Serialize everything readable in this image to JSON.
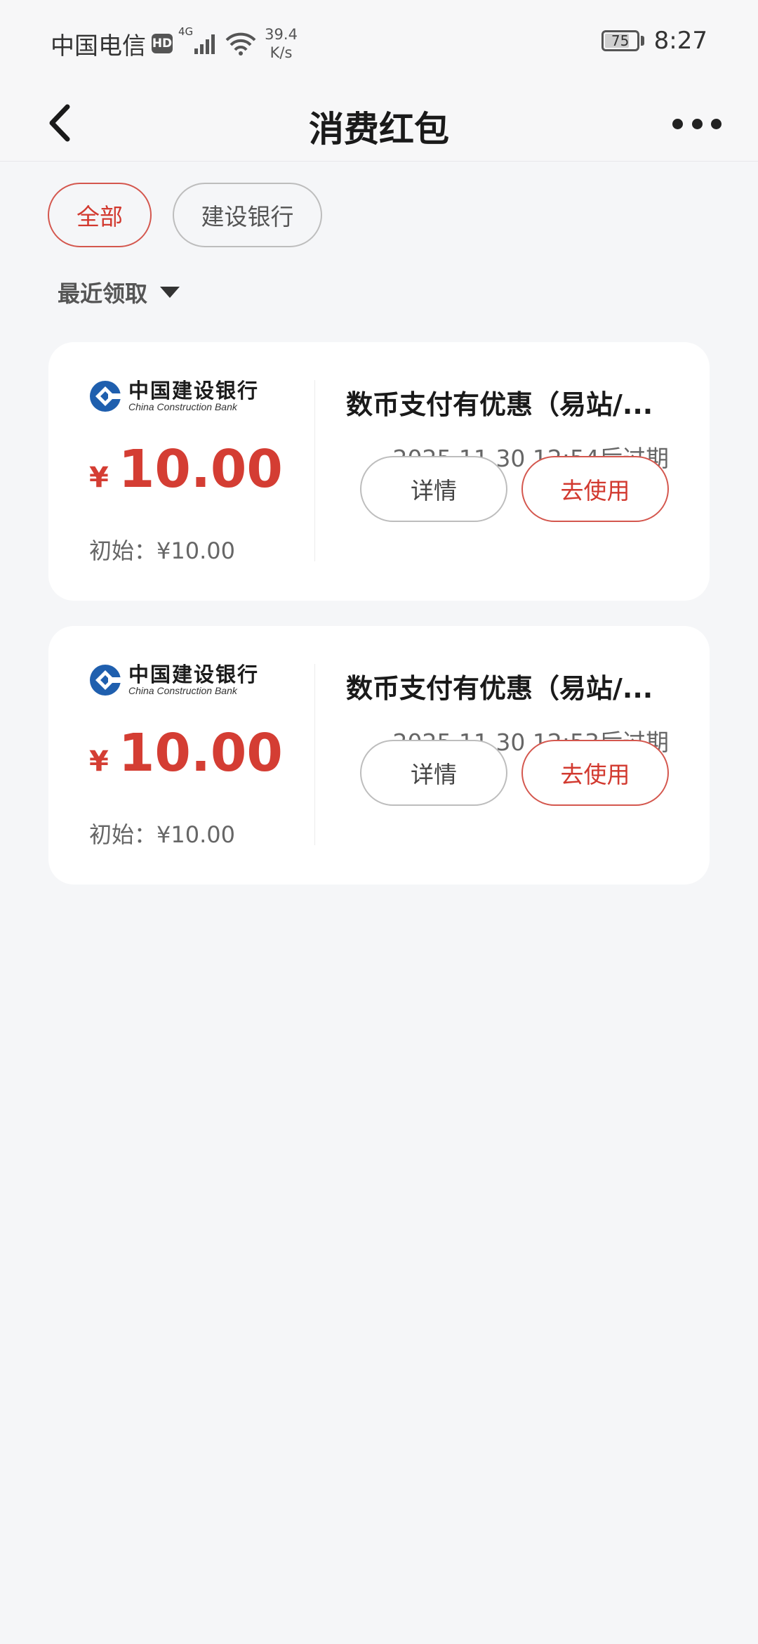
{
  "status_bar": {
    "carrier": "中国电信",
    "hd": "HD",
    "network": "4G",
    "speed_value": "39.4",
    "speed_unit": "K/s",
    "battery": "75",
    "time": "8:27"
  },
  "nav": {
    "title": "消费红包"
  },
  "filters": {
    "all_label": "全部",
    "bank_label": "建设银行"
  },
  "sort": {
    "label": "最近领取"
  },
  "bank_logo": {
    "cn": "中国建设银行",
    "en": "China Construction Bank"
  },
  "coupons": [
    {
      "currency": "¥",
      "amount": "10.00",
      "initial": "初始：¥10.00",
      "title": "数币支付有优惠（易站/...",
      "expire": "2025.11.30 12:54后过期",
      "detail_label": "详情",
      "use_label": "去使用"
    },
    {
      "currency": "¥",
      "amount": "10.00",
      "initial": "初始：¥10.00",
      "title": "数币支付有优惠（易站/...",
      "expire": "2025.11.30 12:53后过期",
      "detail_label": "详情",
      "use_label": "去使用"
    }
  ],
  "colors": {
    "accent": "#d2392f",
    "background": "#f5f6f8",
    "card": "#ffffff",
    "bank_blue": "#1f5fae"
  }
}
